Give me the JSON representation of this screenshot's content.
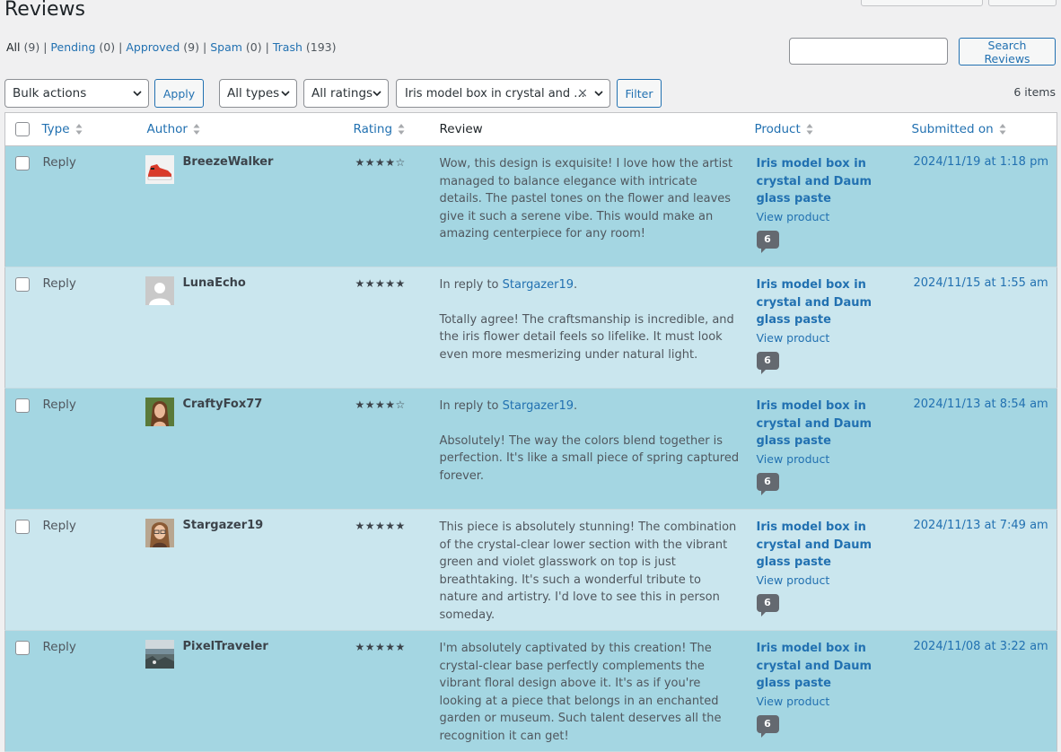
{
  "page": {
    "title": "Reviews"
  },
  "filters_nav": [
    {
      "label": "All",
      "count": "(9)"
    },
    {
      "label": "Pending",
      "count": "(0)"
    },
    {
      "label": "Approved",
      "count": "(9)"
    },
    {
      "label": "Spam",
      "count": "(0)"
    },
    {
      "label": "Trash",
      "count": "(193)"
    }
  ],
  "search": {
    "placeholder": "",
    "button_label": "Search Reviews"
  },
  "toolbar": {
    "bulk_actions": "Bulk actions",
    "apply_label": "Apply",
    "types": "All types",
    "ratings": "All ratings",
    "product_filter": "Iris model box in crystal and ...",
    "filter_label": "Filter",
    "items_count": "6 items"
  },
  "columns": {
    "type": "Type",
    "author": "Author",
    "rating": "Rating",
    "review": "Review",
    "product": "Product",
    "submitted": "Submitted on"
  },
  "rows": [
    {
      "type": "Reply",
      "author": "BreezeWalker",
      "avatar": "sneaker-avatar",
      "rating": "★★★★☆",
      "reply_prefix": "",
      "reply_to": "",
      "review": "Wow, this design is exquisite! I love how the artist managed to balance elegance with intricate details. The pastel tones on the flower and leaves give it such a serene vibe. This would make an amazing centerpiece for any room!",
      "product": "Iris model box in crystal and Daum glass paste",
      "view_product": "View product",
      "comment_count": "6",
      "date": "2024/11/19 at 1:18 pm"
    },
    {
      "type": "Reply",
      "author": "LunaEcho",
      "avatar": "default-avatar",
      "rating": "★★★★★",
      "reply_prefix": "In reply to",
      "reply_to": "Stargazer19",
      "review": "Totally agree! The craftsmanship is incredible, and the iris flower detail feels so lifelike. It must look even more mesmerizing under natural light.",
      "product": "Iris model box in crystal and Daum glass paste",
      "view_product": "View product",
      "comment_count": "6",
      "date": "2024/11/15 at 1:55 am"
    },
    {
      "type": "Reply",
      "author": "CraftyFox77",
      "avatar": "woman-avatar",
      "rating": "★★★★☆",
      "reply_prefix": "In reply to",
      "reply_to": "Stargazer19",
      "review": "Absolutely! The way the colors blend together is perfection. It's like a small piece of spring captured forever.",
      "product": "Iris model box in crystal and Daum glass paste",
      "view_product": "View product",
      "comment_count": "6",
      "date": "2024/11/13 at 8:54 am"
    },
    {
      "type": "Reply",
      "author": "Stargazer19",
      "avatar": "glasses-avatar",
      "rating": "★★★★★",
      "reply_prefix": "",
      "reply_to": "",
      "review": "This piece is absolutely stunning! The combination of the crystal-clear lower section with the vibrant green and violet glasswork on top is just breathtaking. It's such a wonderful tribute to nature and artistry. I'd love to see this in person someday.",
      "product": "Iris model box in crystal and Daum glass paste",
      "view_product": "View product",
      "comment_count": "6",
      "date": "2024/11/13 at 7:49 am"
    },
    {
      "type": "Reply",
      "author": "PixelTraveler",
      "avatar": "landscape-avatar",
      "rating": "★★★★★",
      "reply_prefix": "",
      "reply_to": "",
      "review": "I'm absolutely captivated by this creation! The crystal-clear base perfectly complements the vibrant floral design above it. It's as if you're looking at a piece that belongs in an enchanted garden or museum. Such talent deserves all the recognition it can get!",
      "product": "Iris model box in crystal and Daum glass paste",
      "view_product": "View product",
      "comment_count": "6",
      "date": "2024/11/08 at 3:22 am"
    }
  ]
}
